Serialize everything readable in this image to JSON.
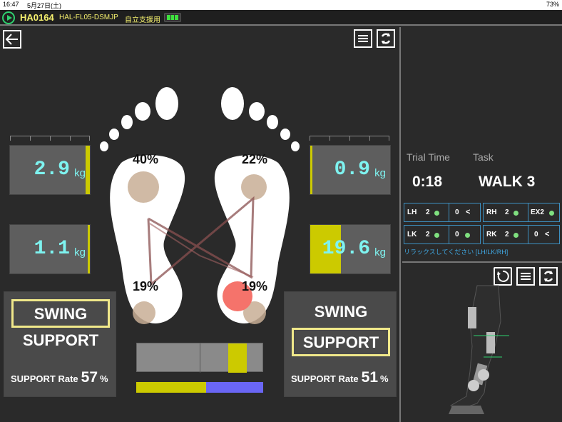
{
  "status_bar": {
    "time": "16:47",
    "date": "5月27日(土)",
    "battery": "73%"
  },
  "header": {
    "device_id": "HA0164",
    "model": "HAL-FL05-DSMJP",
    "mode": "自立支援用"
  },
  "left_foot": {
    "toe_pct": "40%",
    "heel_pct": "19%"
  },
  "right_foot": {
    "toe_pct": "22%",
    "heel_pct": "19%"
  },
  "loads": {
    "left_top": {
      "value": "2.9",
      "unit": "kg",
      "level": 0.05
    },
    "left_bottom": {
      "value": "1.1",
      "unit": "kg",
      "level": 0.03
    },
    "right_top": {
      "value": "0.9",
      "unit": "kg",
      "level": 0.02
    },
    "right_bottom": {
      "value": "19.6",
      "unit": "kg",
      "level": 0.38
    }
  },
  "left_phase": {
    "swing": "SWING",
    "support": "SUPPORT",
    "active": "swing",
    "rate_label": "SUPPORT Rate",
    "rate_value": "57",
    "rate_unit": "%"
  },
  "right_phase": {
    "swing": "SWING",
    "support": "SUPPORT",
    "active": "support",
    "rate_label": "SUPPORT Rate",
    "rate_value": "51",
    "rate_unit": "%"
  },
  "balance": {
    "left_share": 0.55,
    "right_share": 0.45
  },
  "trial": {
    "time_label": "Trial Time",
    "task_label": "Task",
    "time_value": "0:18",
    "task_value": "WALK 3"
  },
  "joints": [
    {
      "name": "LH",
      "a": "2",
      "b": "0",
      "b_icon": "arrow-left"
    },
    {
      "name": "RH",
      "a": "2",
      "b": "EX2",
      "b_icon": "dot"
    },
    {
      "name": "LK",
      "a": "2",
      "b": "0",
      "b_icon": "dot"
    },
    {
      "name": "RK",
      "a": "2",
      "b": "0",
      "b_icon": "arrow-left"
    }
  ],
  "relax_msg": "リラックスしてください [LH/LK/RH]",
  "colors": {
    "accent_yellow": "#f5f06e",
    "value_cyan": "#7ef3f0",
    "bar_yellow": "#ccca00",
    "bar_blue": "#6a66f5",
    "joint_border": "#3d8fbf"
  },
  "icons": [
    "back-arrow-icon",
    "menu-icon",
    "refresh-icon",
    "reset-icon",
    "play-icon",
    "battery-icon"
  ]
}
